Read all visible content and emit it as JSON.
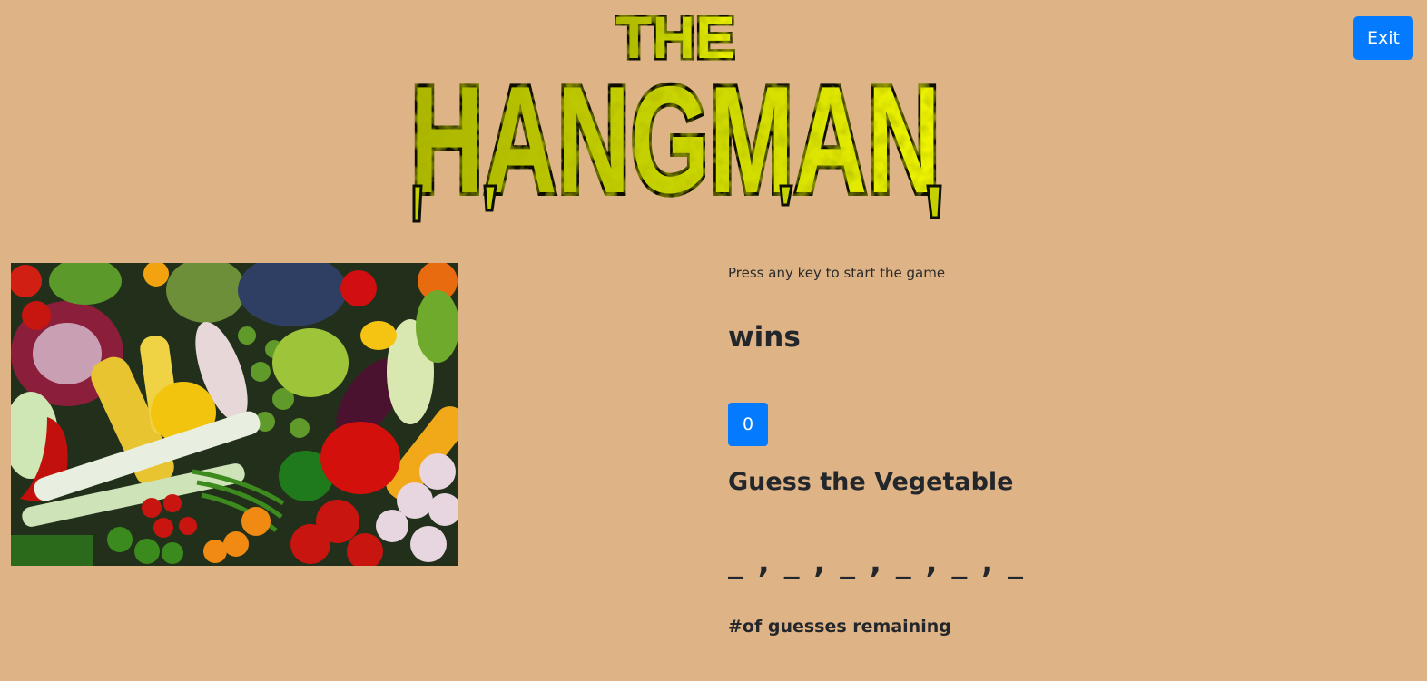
{
  "colors": {
    "background": "#deb487",
    "accent": "#047bfe",
    "logo_fill": "#c8d400",
    "logo_outline": "#0b0f05"
  },
  "header": {
    "exit_label": "Exit",
    "logo_text_top": "THE",
    "logo_text_main": "HANGMAN"
  },
  "game": {
    "instruction": "Press any key to start the game",
    "wins_label": "wins",
    "wins_count": "0",
    "guess_title": "Guess the Vegetable",
    "word_display": "_ , _ , _ , _ , _ , _",
    "guesses_label": "#of guesses remaining"
  },
  "image": {
    "icon": "vegetables-image"
  }
}
